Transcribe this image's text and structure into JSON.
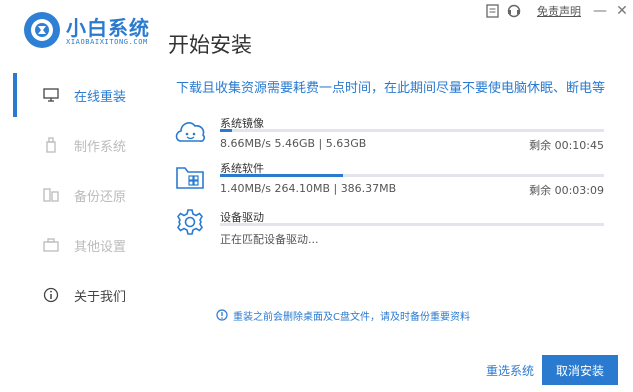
{
  "header": {
    "logo_cn": "小白系统",
    "logo_en": "XIAOBAIXITONG.COM",
    "page_title": "开始安装",
    "disclaimer": "免责声明",
    "minimize": "—",
    "close": "✕"
  },
  "sidebar": {
    "items": [
      {
        "label": "在线重装",
        "icon": "monitor-icon",
        "active": true
      },
      {
        "label": "制作系统",
        "icon": "usb-icon"
      },
      {
        "label": "备份还原",
        "icon": "backup-icon"
      },
      {
        "label": "其他设置",
        "icon": "briefcase-icon"
      },
      {
        "label": "关于我们",
        "icon": "info-icon"
      }
    ]
  },
  "main": {
    "notice": "下载且收集资源需要耗费一点时间，在此期间尽量不要使电脑休眠、断电等",
    "tasks": [
      {
        "name": "系统镜像",
        "speed": "8.66MB/s 5.46GB | 5.63GB",
        "remaining": "剩余 00:10:45",
        "progress": 0.03,
        "icon": "cloud-face-icon"
      },
      {
        "name": "系统软件",
        "speed": "1.40MB/s 264.10MB | 386.37MB",
        "remaining": "剩余 00:03:09",
        "progress": 0.32,
        "icon": "folder-apps-icon"
      },
      {
        "name": "设备驱动",
        "speed": "正在匹配设备驱动...",
        "remaining": "",
        "progress": 0.0,
        "icon": "gear-icon"
      }
    ],
    "warning": "重装之前会删除桌面及C盘文件，请及时备份重要资料",
    "reselect_label": "重选系统",
    "cancel_label": "取消安装"
  },
  "colors": {
    "accent": "#2a7bd0",
    "track": "#e2e6ec"
  }
}
